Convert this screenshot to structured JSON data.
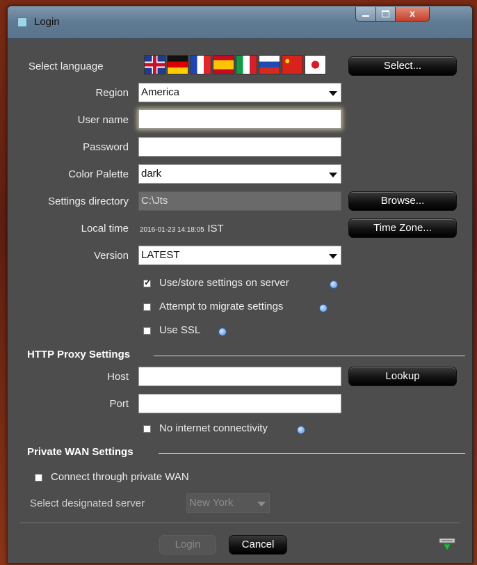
{
  "window": {
    "title": "Login",
    "close_glyph": "x"
  },
  "form": {
    "language_label": "Select language",
    "select_button": "Select...",
    "region_label": "Region",
    "region_value": "America",
    "username_label": "User name",
    "username_value": "",
    "password_label": "Password",
    "password_value": "",
    "palette_label": "Color Palette",
    "palette_value": "dark",
    "settings_dir_label": "Settings directory",
    "settings_dir_value": "C:\\Jts",
    "browse_button": "Browse...",
    "local_time_label": "Local time",
    "local_time_value": "2016-01-23 14:18:05",
    "timezone_abbrev": "IST",
    "timezone_button": "Time Zone...",
    "version_label": "Version",
    "version_value": "LATEST",
    "checkboxes": [
      {
        "label": "Use/store settings on server",
        "checked": true
      },
      {
        "label": "Attempt to migrate settings",
        "checked": false
      },
      {
        "label": "Use SSL",
        "checked": false
      }
    ]
  },
  "proxy": {
    "section_title": "HTTP Proxy Settings",
    "host_label": "Host",
    "host_value": "",
    "port_label": "Port",
    "port_value": "",
    "lookup_button": "Lookup",
    "no_internet_label": "No internet connectivity",
    "no_internet_checked": false
  },
  "wan": {
    "section_title": "Private WAN Settings",
    "connect_label": "Connect through private WAN",
    "connect_checked": false,
    "server_label": "Select designated server",
    "server_value": "New York"
  },
  "footer": {
    "login_button": "Login",
    "cancel_button": "Cancel"
  },
  "flags": [
    "uk-flag-icon",
    "germany-flag-icon",
    "france-flag-icon",
    "spain-flag-icon",
    "italy-flag-icon",
    "russia-flag-icon",
    "china-flag-icon",
    "japan-flag-icon"
  ]
}
